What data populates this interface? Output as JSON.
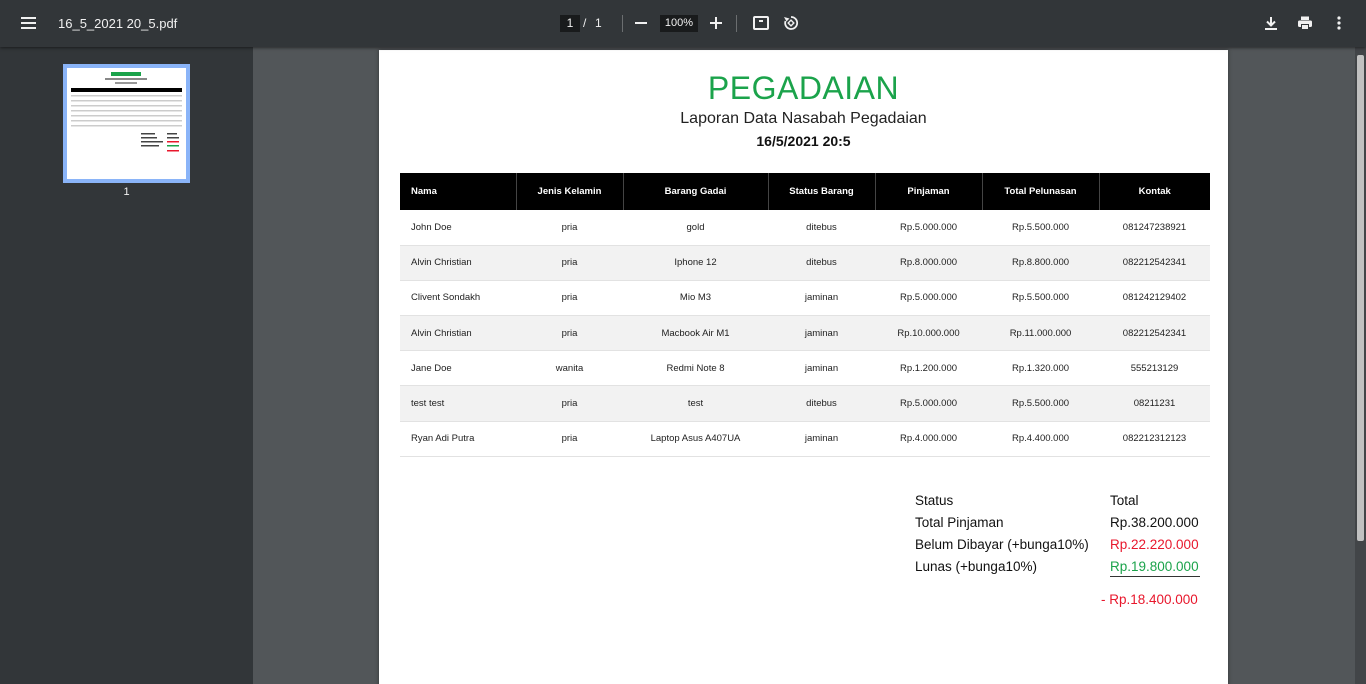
{
  "toolbar": {
    "file_name": "16_5_2021 20_5.pdf",
    "current_page": "1",
    "page_separator": "/",
    "total_pages": "1",
    "zoom": "100%",
    "icons": [
      "menu-icon",
      "zoom-out-icon",
      "zoom-in-icon",
      "fit-page-icon",
      "rotate-icon",
      "download-icon",
      "print-icon",
      "more-options-icon"
    ]
  },
  "sidebar": {
    "thumbnail_number": "1"
  },
  "document": {
    "title": "PEGADAIAN",
    "subtitle": "Laporan Data Nasabah Pegadaian",
    "date": "16/5/2021 20:5",
    "table": {
      "columns": [
        "Nama",
        "Jenis Kelamin",
        "Barang Gadai",
        "Status Barang",
        "Pinjaman",
        "Total Pelunasan",
        "Kontak"
      ],
      "rows": [
        [
          "John Doe",
          "pria",
          "gold",
          "ditebus",
          "Rp.5.000.000",
          "Rp.5.500.000",
          "081247238921"
        ],
        [
          "Alvin Christian",
          "pria",
          "Iphone 12",
          "ditebus",
          "Rp.8.000.000",
          "Rp.8.800.000",
          "082212542341"
        ],
        [
          "Clivent Sondakh",
          "pria",
          "Mio M3",
          "jaminan",
          "Rp.5.000.000",
          "Rp.5.500.000",
          "081242129402"
        ],
        [
          "Alvin Christian",
          "pria",
          "Macbook Air M1",
          "jaminan",
          "Rp.10.000.000",
          "Rp.11.000.000",
          "082212542341"
        ],
        [
          "Jane Doe",
          "wanita",
          "Redmi Note 8",
          "jaminan",
          "Rp.1.200.000",
          "Rp.1.320.000",
          "555213129"
        ],
        [
          "test test",
          "pria",
          "test",
          "ditebus",
          "Rp.5.000.000",
          "Rp.5.500.000",
          "08211231"
        ],
        [
          "Ryan Adi Putra",
          "pria",
          "Laptop Asus A407UA",
          "jaminan",
          "Rp.4.000.000",
          "Rp.4.400.000",
          "082212312123"
        ]
      ]
    },
    "summary": {
      "header_label": "Status",
      "header_value": "Total",
      "rows": [
        {
          "label": "Total Pinjaman",
          "value": "Rp.38.200.000"
        },
        {
          "label": "Belum Dibayar (+bunga10%)",
          "value": "Rp.22.220.000"
        },
        {
          "label": "Lunas (+bunga10%)",
          "value": "Rp.19.800.000"
        }
      ],
      "difference": "- Rp.18.400.000"
    }
  },
  "colors": {
    "title_green": "#1ba34b",
    "red": "#e8172c",
    "toolbar_bg": "#323639",
    "viewer_bg": "#525659"
  }
}
